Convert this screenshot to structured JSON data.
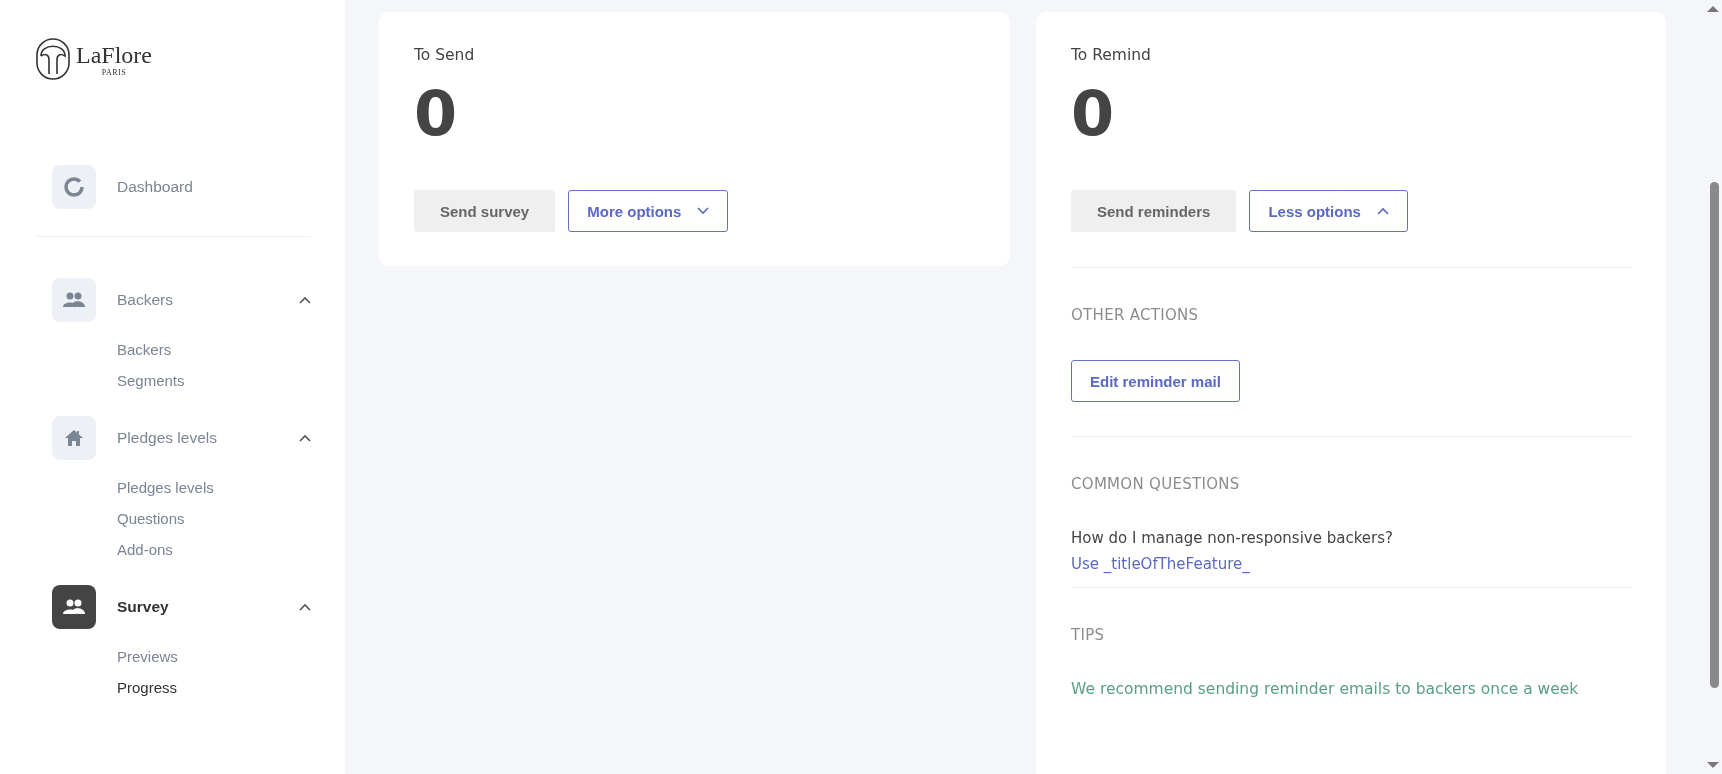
{
  "logo": {
    "name": "LaFlore",
    "subtitle": "PARIS"
  },
  "nav": [
    {
      "label": "Dashboard",
      "selected": false
    },
    {
      "label": "Backers",
      "selected": false,
      "expanded": true,
      "children": [
        {
          "label": "Backers",
          "selected": false
        },
        {
          "label": "Segments",
          "selected": false
        }
      ]
    },
    {
      "label": "Pledges levels",
      "selected": false,
      "expanded": true,
      "children": [
        {
          "label": "Pledges levels",
          "selected": false
        },
        {
          "label": "Questions",
          "selected": false
        },
        {
          "label": "Add-ons",
          "selected": false
        }
      ]
    },
    {
      "label": "Survey",
      "selected": true,
      "expanded": true,
      "children": [
        {
          "label": "Previews",
          "selected": false
        },
        {
          "label": "Progress",
          "selected": true
        }
      ]
    }
  ],
  "cards": [
    {
      "title": "To Send",
      "count": "0",
      "action": "Send survey",
      "toggle": {
        "label": "More options",
        "expanded": false
      }
    },
    {
      "title": "To Remind",
      "count": "0",
      "action": "Send reminders",
      "toggle": {
        "label": "Less options",
        "expanded": true
      },
      "sections": [
        {
          "kind": "actions",
          "heading": "OTHER ACTIONS",
          "buttons": [
            "Edit reminder mail"
          ]
        },
        {
          "kind": "faq",
          "heading": "COMMON QUESTIONS",
          "question": "How do I manage non-responsive backers?",
          "link": "Use _titleOfTheFeature_"
        },
        {
          "kind": "tip",
          "heading": "TIPS",
          "text": "We recommend sending reminder emails to backers once a week"
        }
      ]
    }
  ]
}
